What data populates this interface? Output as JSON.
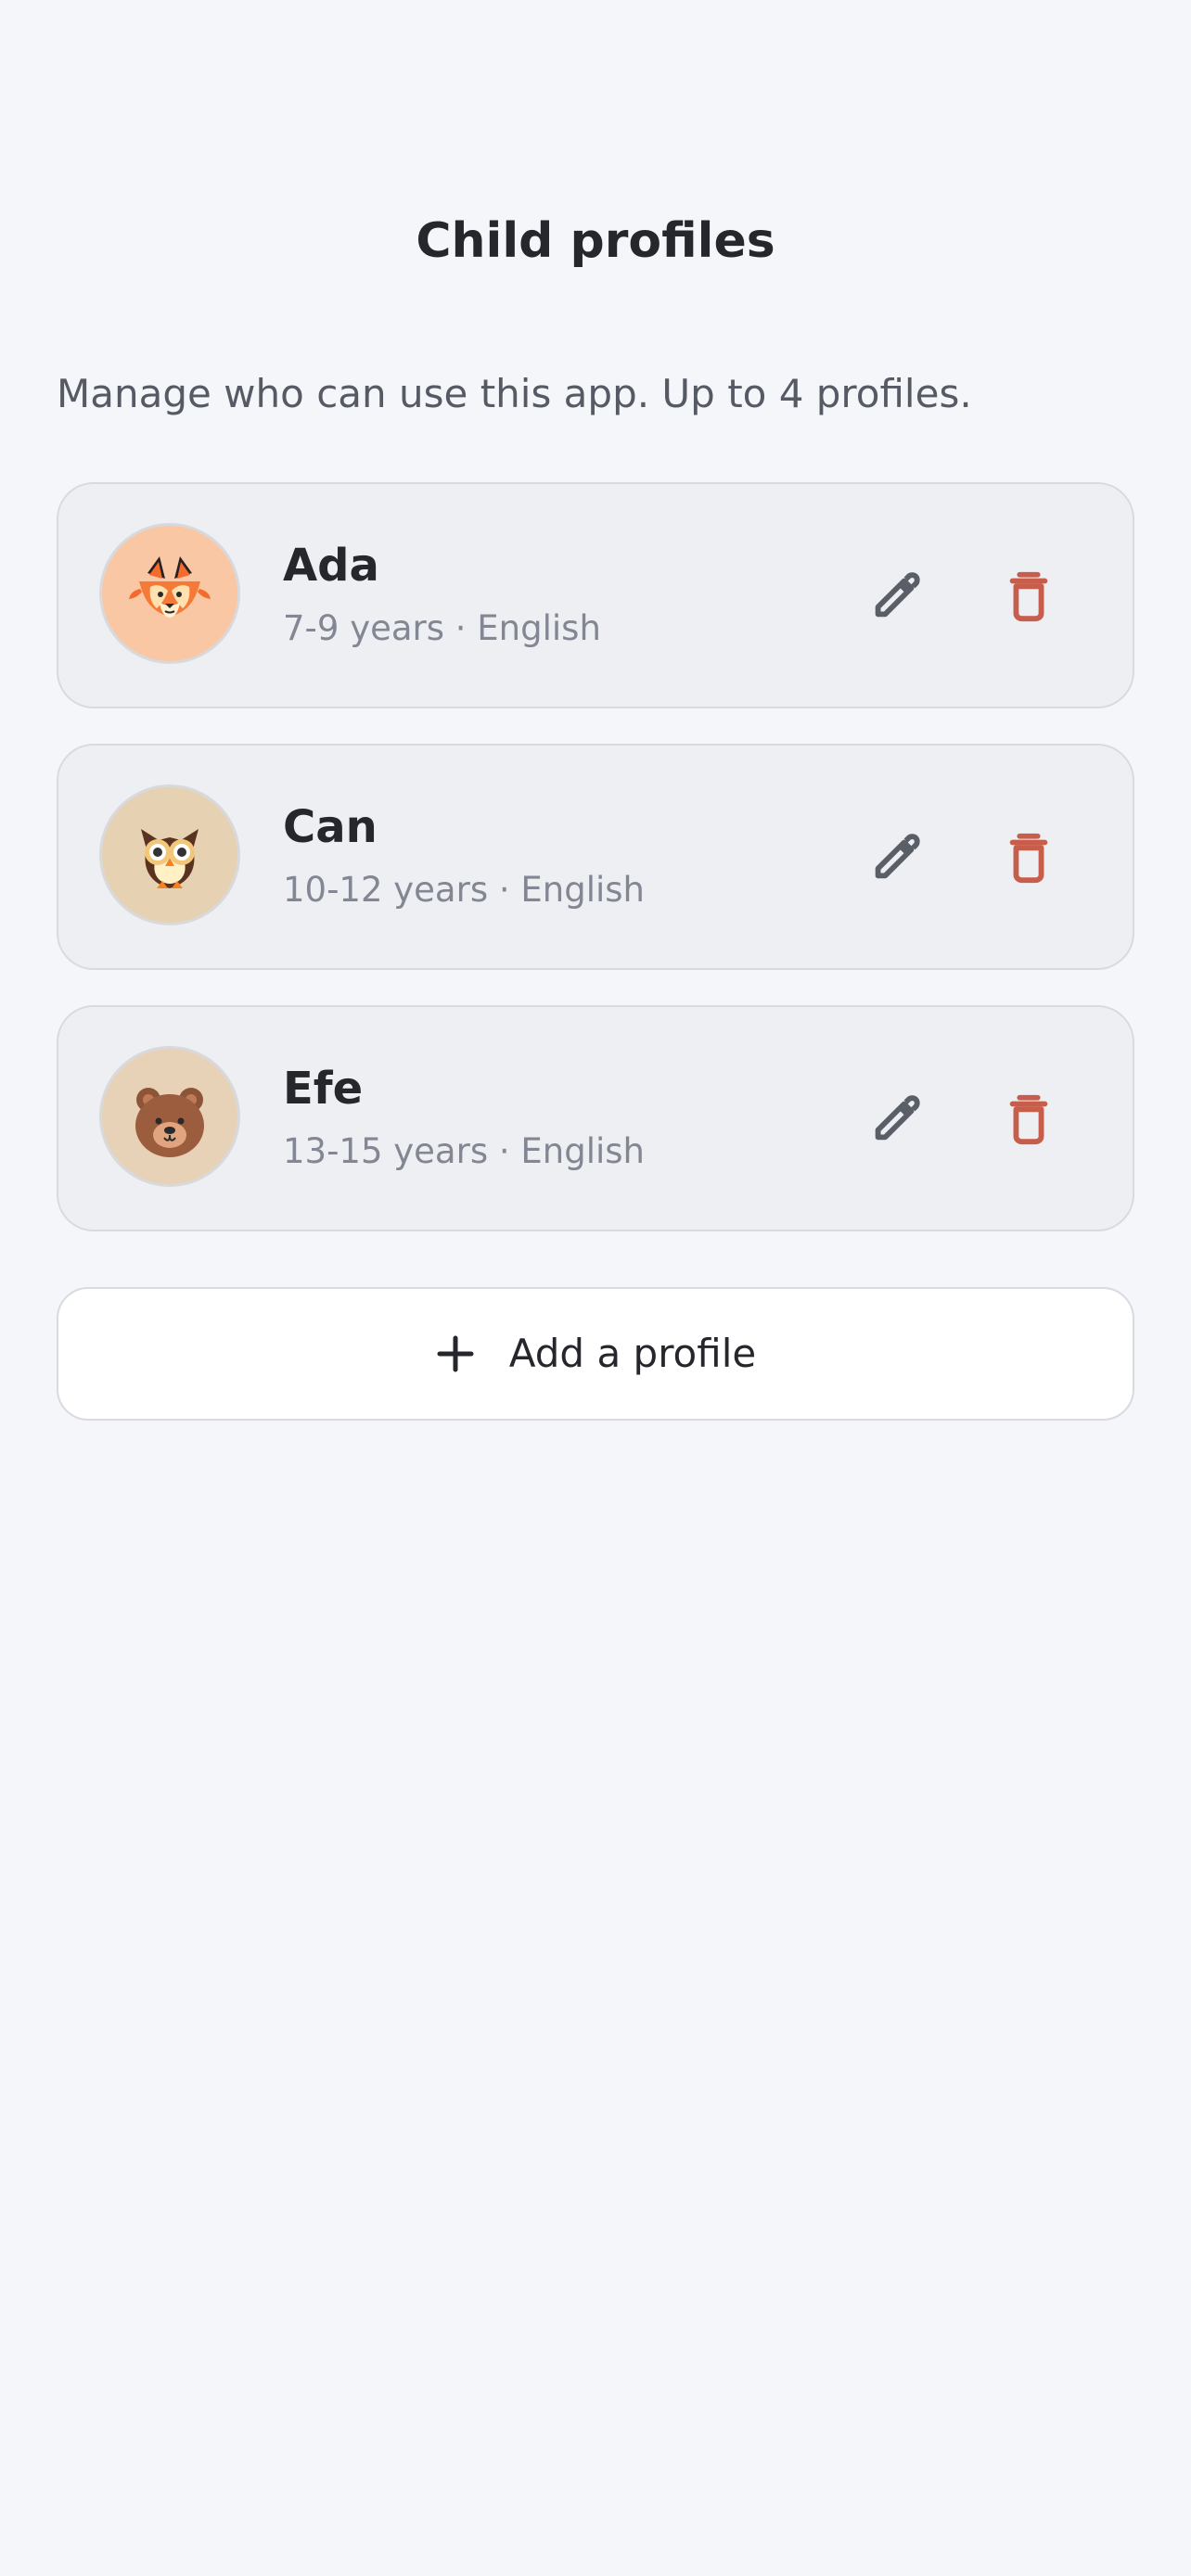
{
  "header": {
    "title": "Child profiles"
  },
  "intro": {
    "description": "Manage who can use this app. Up to 4 profiles."
  },
  "profiles": [
    {
      "name": "Ada",
      "meta": "7-9 years · English",
      "avatar_icon": "fox-icon",
      "avatar_bg": "#f9c7a3"
    },
    {
      "name": "Can",
      "meta": "10-12 years · English",
      "avatar_icon": "owl-icon",
      "avatar_bg": "#e6d1b2"
    },
    {
      "name": "Efe",
      "meta": "13-15 years · English",
      "avatar_icon": "bear-icon",
      "avatar_bg": "#e7d2b7"
    }
  ],
  "actions": {
    "edit_icon": "pencil-icon",
    "delete_icon": "trash-icon",
    "add_label": "Add a profile",
    "add_icon": "plus-icon"
  },
  "colors": {
    "background": "#f5f6f9",
    "card": "#eeeff3",
    "text_primary": "#25272c",
    "text_secondary": "#828793",
    "delete": "#c75d4b"
  }
}
